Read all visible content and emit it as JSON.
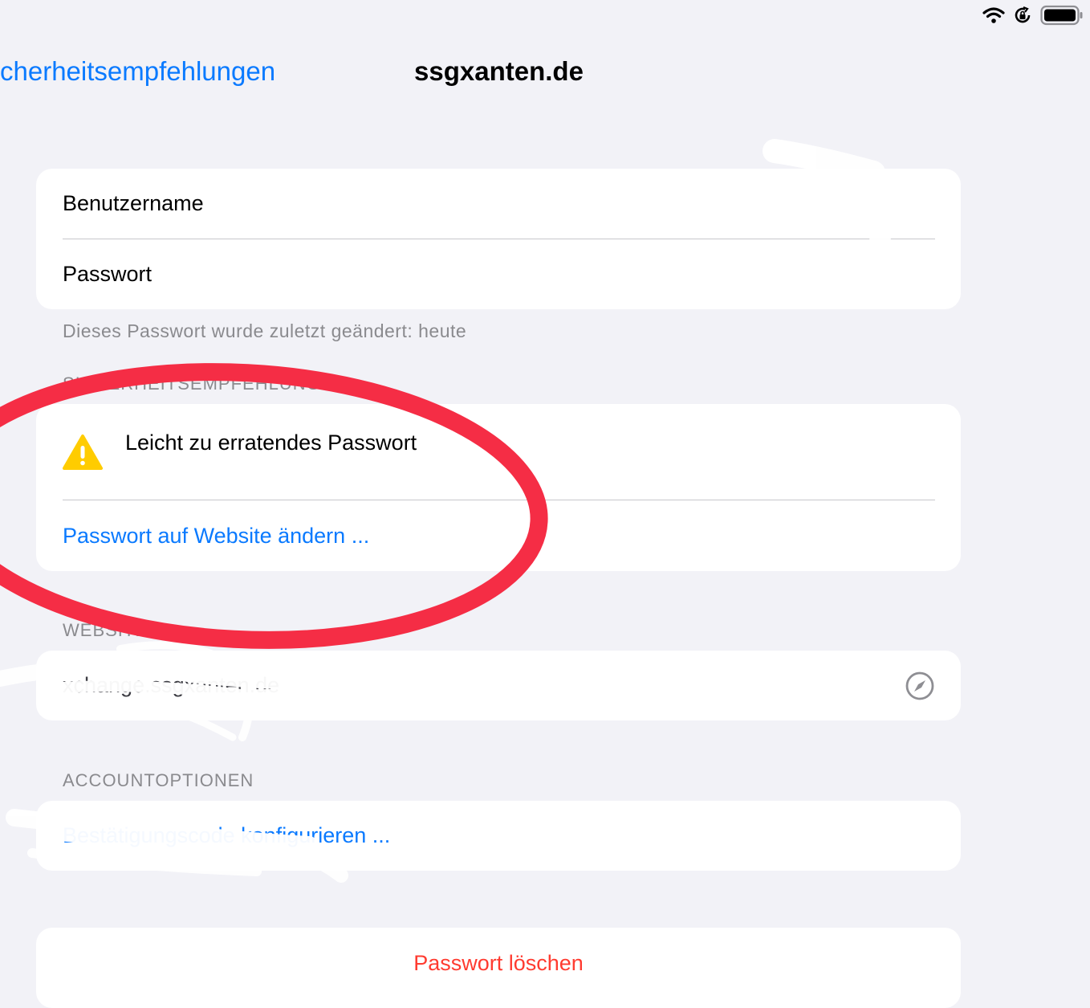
{
  "status_bar": {
    "icons": [
      "wifi-icon",
      "rotation-lock-icon",
      "battery-icon"
    ]
  },
  "nav": {
    "back_label": "cherheitsempfehlungen",
    "title": "ssgxanten.de"
  },
  "credentials": {
    "username_label": "Benutzername",
    "password_label": "Passwort"
  },
  "last_changed": "Dieses Passwort wurde zuletzt geändert: heute",
  "security": {
    "header": "SICHERHEITSEMPFEHLUNGEN",
    "warning_icon": "warning-triangle-icon",
    "warning_text": "Leicht zu erratendes Passwort",
    "change_link": "Passwort auf Website ändern ..."
  },
  "website": {
    "header": "WEBSITE",
    "url": "xchange.ssgxanten.de",
    "open_icon": "compass-icon"
  },
  "account_options": {
    "header": "ACCOUNTOPTIONEN",
    "link": "Bestätigungscode konfigurieren ..."
  },
  "delete_label": "Passwort löschen",
  "colors": {
    "accent": "#0a7aff",
    "destructive": "#ff3b30",
    "annotation": "#f52d45",
    "warning": "#ffcc00",
    "background": "#f2f2f7"
  }
}
